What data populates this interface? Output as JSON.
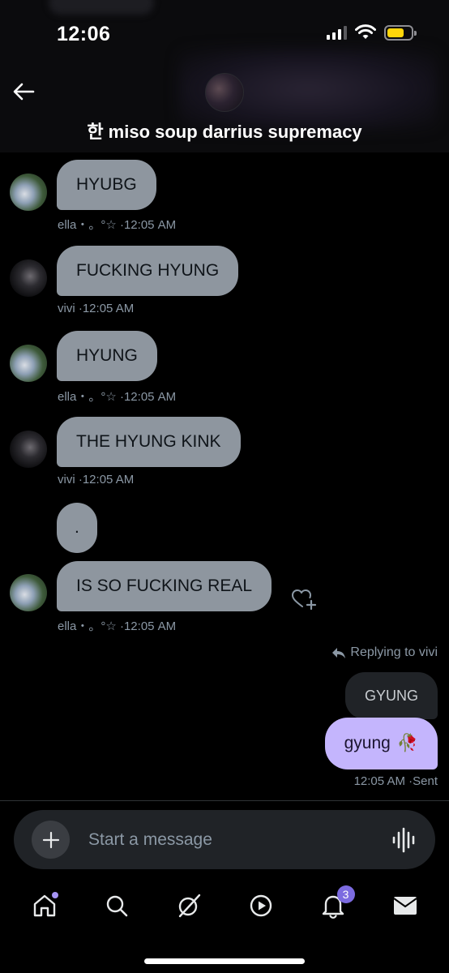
{
  "status_bar": {
    "time": "12:06"
  },
  "header": {
    "title": "한 miso soup darrius supremacy"
  },
  "messages": [
    {
      "text": "HYUBG",
      "sender": "ella・。°☆",
      "time": "·12:05 AM"
    },
    {
      "text": "FUCKING HYUNG",
      "sender": "vivi",
      "time": "·12:05 AM"
    },
    {
      "text": "HYUNG",
      "sender": "ella・。°☆",
      "time": "·12:05 AM"
    },
    {
      "text": "THE HYUNG KINK",
      "sender": "vivi",
      "time": "·12:05 AM"
    },
    {
      "text": "."
    },
    {
      "text": "IS SO FUCKING REAL",
      "sender": "ella・。°☆",
      "time": "·12:05 AM"
    }
  ],
  "my_message": {
    "replying_to": "Replying to vivi",
    "quoted_text": "GYUNG",
    "text": "gyung",
    "emoji": "🥀",
    "time": "12:05 AM",
    "status": "·Sent"
  },
  "composer": {
    "placeholder": "Start a message"
  },
  "nav": {
    "notifications_badge": "3"
  },
  "colors": {
    "incoming_bubble": "#8e969f",
    "outgoing_bubble": "#c4b5fd",
    "accent": "#7c6be0"
  }
}
